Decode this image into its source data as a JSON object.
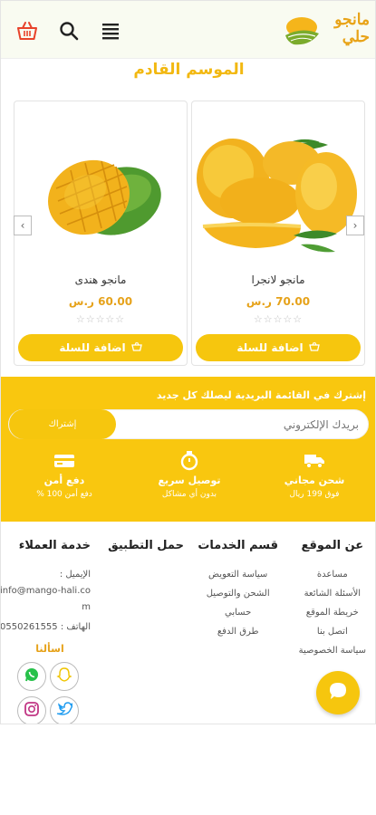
{
  "header": {
    "logo_text_line1": "مانجو",
    "logo_text_line2": "حلي"
  },
  "section_title": "الموسم القادم",
  "products": [
    {
      "name": "مانجو لانجرا",
      "price": "70.00 ر.س",
      "stars": "☆☆☆☆☆",
      "button_label": "اضافة للسلة"
    },
    {
      "name": "مانجو هندى",
      "price": "60.00 ر.س",
      "stars": "☆☆☆☆☆",
      "button_label": "اضافة للسلة"
    }
  ],
  "newsletter": {
    "text": "إشترك في القائمة البريدية ليصلك كل جديد",
    "email_placeholder": "بريدك الإلكتروني",
    "subscribe_label": "إشتراك"
  },
  "features": [
    {
      "title": "شحن مجاني",
      "subtitle": "فوق 199 ريال",
      "icon": "truck-icon"
    },
    {
      "title": "توصيل سريع",
      "subtitle": "بدون أي مشاكل",
      "icon": "stopwatch-icon"
    },
    {
      "title": "دفع أمن",
      "subtitle": "دفع أمن 100 %",
      "icon": "credit-card-icon"
    }
  ],
  "footer": {
    "about": {
      "title": "عن الموقع",
      "links": [
        "مساعدة",
        "الأسئلة الشائعة",
        "خريطة الموقع",
        "اتصل بنا",
        "سياسة الخصوصية"
      ]
    },
    "services": {
      "title": "قسم الخدمات",
      "links": [
        "سياسة التعويض",
        "الشحن والتوصيل",
        "حسابي",
        "طرق الدفع"
      ]
    },
    "app": {
      "title": "حمل التطبيق"
    },
    "support": {
      "title": "خدمة العملاء",
      "email_label": "الإيميل :",
      "email_value": "info@mango-hali.com",
      "phone": "الهاتف : 0550261555",
      "ask_us": "اسألنا"
    }
  },
  "colors": {
    "accent": "#f6c60e",
    "price": "#e6a21a",
    "header_bg": "#f9fbf1"
  }
}
